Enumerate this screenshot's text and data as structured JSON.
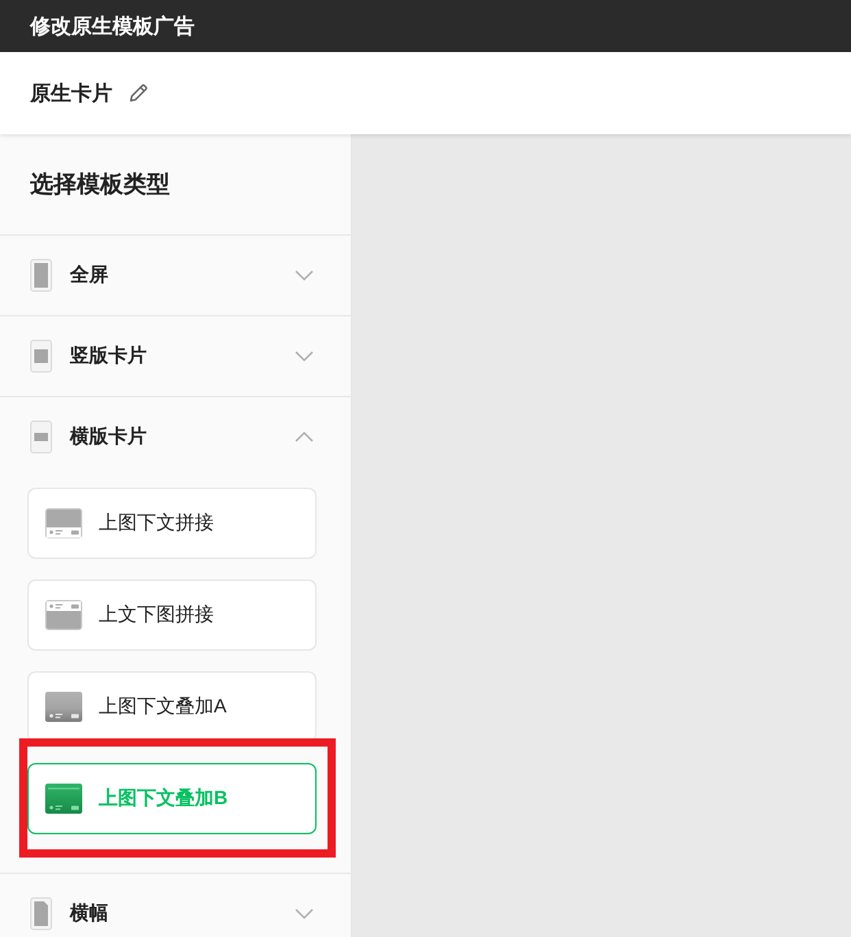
{
  "window": {
    "title": "修改原生模板广告"
  },
  "header": {
    "title": "原生卡片"
  },
  "sidebar": {
    "heading": "选择模板类型",
    "sections": [
      {
        "label": "全屏",
        "kind": "fullscreen",
        "expanded": false
      },
      {
        "label": "竖版卡片",
        "kind": "portrait",
        "expanded": false
      },
      {
        "label": "横版卡片",
        "kind": "landscape",
        "expanded": true,
        "templates": [
          {
            "label": "上图下文拼接",
            "kind": "below",
            "selected": false,
            "highlighted": false
          },
          {
            "label": "上文下图拼接",
            "kind": "above",
            "selected": false,
            "highlighted": false
          },
          {
            "label": "上图下文叠加A",
            "kind": "fade",
            "selected": false,
            "highlighted": false
          },
          {
            "label": "上图下文叠加B",
            "kind": "band",
            "selected": true,
            "highlighted": true
          }
        ]
      },
      {
        "label": "横幅",
        "kind": "banner",
        "expanded": false
      }
    ]
  }
}
